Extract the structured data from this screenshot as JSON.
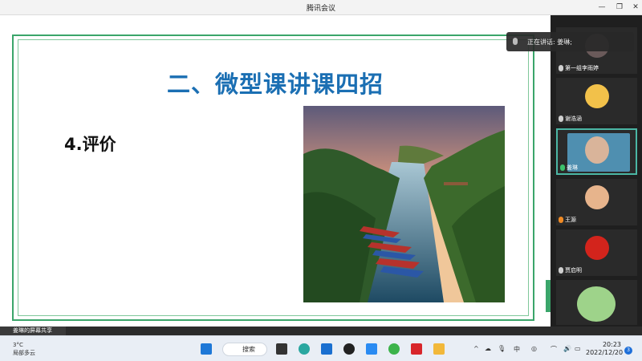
{
  "window": {
    "title": "腾讯会议"
  },
  "slide": {
    "title": "二、微型课讲课四招",
    "subtitle": "4.评价"
  },
  "speaking": {
    "text": "正在讲话: 姜琳;"
  },
  "participants": [
    {
      "name": "第一组李雨婷"
    },
    {
      "name": "谢浩涵"
    },
    {
      "name": "姜琳"
    },
    {
      "name": "王源"
    },
    {
      "name": "贾启明"
    }
  ],
  "share_status": "姜琳的屏幕共享",
  "taskbar": {
    "weather_temp": "3°C",
    "weather_desc": "局部多云",
    "search_label": "搜索",
    "time": "20:23",
    "date": "2022/12/20",
    "notification_count": "3",
    "tray_ime": "中"
  }
}
